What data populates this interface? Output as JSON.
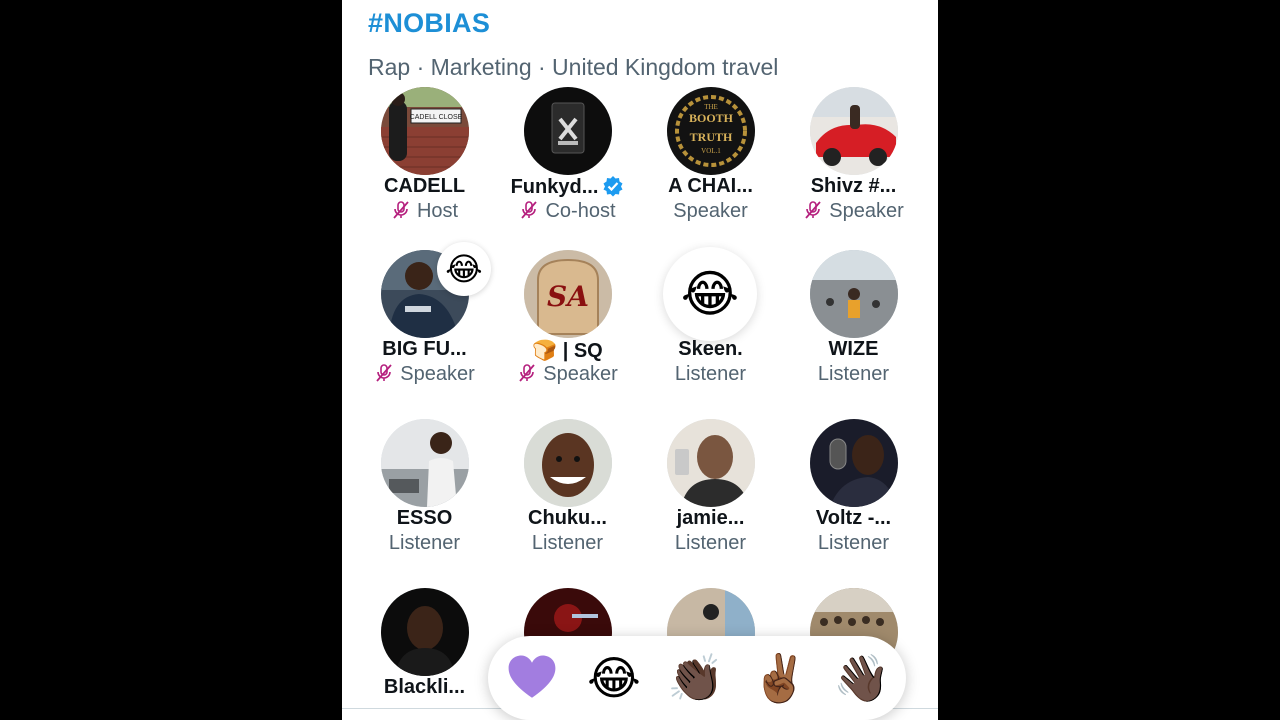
{
  "space": {
    "title": "#NOBIAS",
    "topics": "Rap · Marketing · United Kingdom travel"
  },
  "participants": [
    {
      "name": "CADELL",
      "role": "Host",
      "muted": true
    },
    {
      "name": "Funkyd...",
      "role": "Co-host",
      "muted": true,
      "verified": true
    },
    {
      "name": "A CHAI...",
      "role": "Speaker",
      "muted": false
    },
    {
      "name": "Shivz #...",
      "role": "Speaker",
      "muted": true
    },
    {
      "name": "BIG FU...",
      "role": "Speaker",
      "muted": true,
      "reaction": "😂"
    },
    {
      "name": "🍞 | SQ",
      "role": "Speaker",
      "muted": true
    },
    {
      "name": "Skeen.",
      "role": "Listener",
      "muted": false,
      "reaction": "😂"
    },
    {
      "name": "WIZE",
      "role": "Listener",
      "muted": false
    },
    {
      "name": "ESSO",
      "role": "Listener",
      "muted": false
    },
    {
      "name": "Chuku...",
      "role": "Listener",
      "muted": false
    },
    {
      "name": "jamie...",
      "role": "Listener",
      "muted": false
    },
    {
      "name": "Voltz -...",
      "role": "Listener",
      "muted": false
    },
    {
      "name": "Blackli...",
      "role": "",
      "muted": false
    }
  ],
  "avatar_texts": {
    "cadell_sign": "CADELL CLOSE",
    "booth_line1": "THE",
    "booth_line2": "BOOTH",
    "booth_line3": "TRUTH",
    "booth_line4": "VOL.1",
    "sq_mark": "SA"
  },
  "reactions": {
    "heart": "💜",
    "joy": "😂",
    "clap": "👏🏿",
    "victory": "✌🏾",
    "wave": "👋🏿"
  },
  "colors": {
    "accent": "#1d8fd6",
    "muted_mic": "#b5207e",
    "text_primary": "#0f1419",
    "text_secondary": "#536471",
    "verified": "#1d9bf0",
    "heart": "#a27de0"
  }
}
